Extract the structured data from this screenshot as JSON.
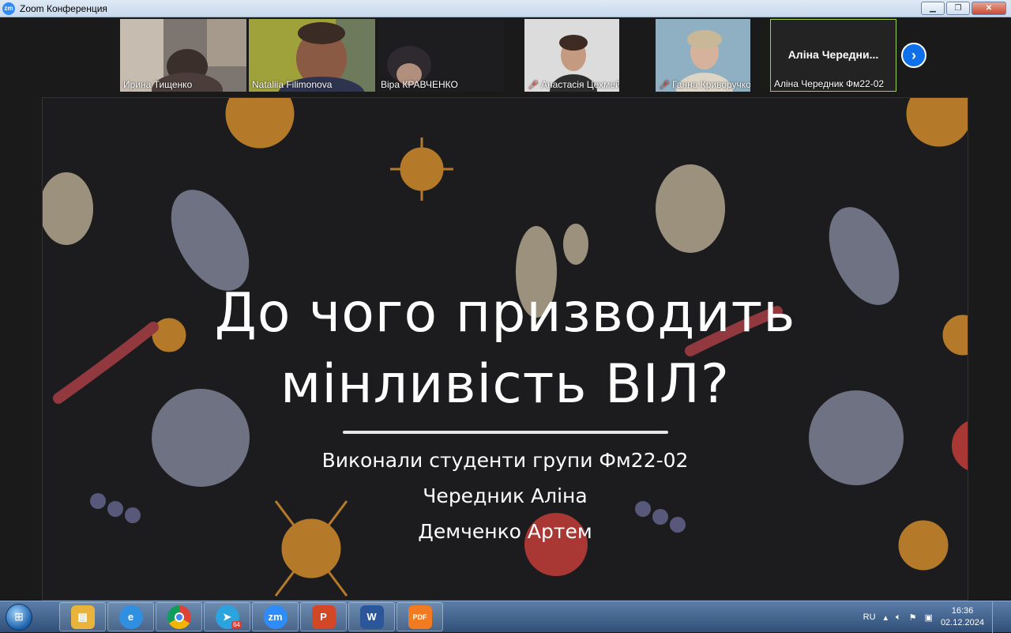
{
  "window": {
    "title": "Zoom Конференция",
    "app_icon": "zm"
  },
  "participants": [
    {
      "name": "Ирина Тищенко",
      "muted": false
    },
    {
      "name": "Nataliia Filimonova",
      "muted": false
    },
    {
      "name": "Віра КРАВЧЕНКО",
      "muted": false
    },
    {
      "name": "Анастасія Цехмейстер",
      "muted": true
    },
    {
      "name": "Ганна Криворучко",
      "muted": true
    },
    {
      "name": "Аліна Чередник Фм22-02",
      "display_name": "Аліна  Чередни...",
      "muted": false,
      "active_speaker": true
    }
  ],
  "slide": {
    "title_line1": "До чого призводить",
    "title_line2": "мінливість ВІЛ?",
    "sub1": "Виконали студенти групи Фм22-02",
    "sub2": "Чередник Аліна",
    "sub3": "Демченко Артем"
  },
  "taskbar": {
    "apps": [
      {
        "name": "explorer",
        "color": "#e8b43c"
      },
      {
        "name": "internet-explorer",
        "color": "#2f8fe0",
        "label": "e"
      },
      {
        "name": "chrome",
        "color": "#db4437"
      },
      {
        "name": "telegram",
        "color": "#2aa3df",
        "badge": "64"
      },
      {
        "name": "zoom",
        "color": "#2d8cff",
        "label": "zm"
      },
      {
        "name": "powerpoint",
        "color": "#d24726",
        "label": "P"
      },
      {
        "name": "word",
        "color": "#2b579a",
        "label": "W"
      },
      {
        "name": "pdf-reader",
        "color": "#f27b21",
        "label": "PDF"
      }
    ],
    "language": "RU",
    "time": "16:36",
    "date": "02.12.2024"
  },
  "colors": {
    "accent": "#0e71eb",
    "active_border": "#9fd34a",
    "mute": "#e0443a"
  }
}
